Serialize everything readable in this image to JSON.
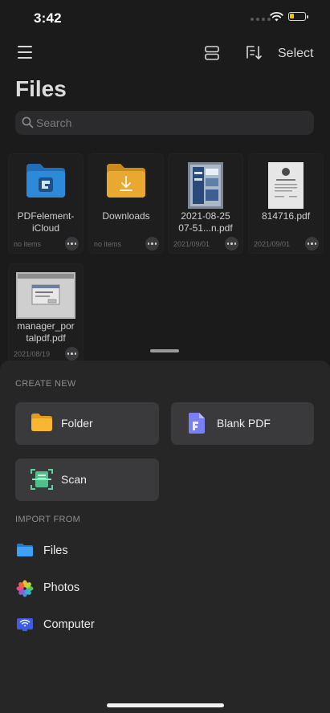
{
  "status_bar": {
    "time": "3:42",
    "battery_level": 0.3
  },
  "toolbar": {
    "select_label": "Select"
  },
  "page": {
    "title": "Files"
  },
  "search": {
    "placeholder": "Search"
  },
  "files": [
    {
      "name_line1": "PDFelement-",
      "name_line2": "iCloud",
      "meta": "no items",
      "kind": "cloud-folder-icon"
    },
    {
      "name_line1": "Downloads",
      "name_line2": "",
      "meta": "no items",
      "kind": "downloads-folder-icon"
    },
    {
      "name_line1": "2021-08-25",
      "name_line2": "07-51...n.pdf",
      "meta": "2021/09/01",
      "kind": "pdf-thumbnail"
    },
    {
      "name_line1": "814716.pdf",
      "name_line2": "",
      "meta": "2021/09/01",
      "kind": "pdf-thumbnail"
    },
    {
      "name_line1": "manager_por",
      "name_line2": "talpdf.pdf",
      "meta": "2021/08/19",
      "kind": "pdf-thumbnail"
    }
  ],
  "create_new": {
    "label": "CREATE NEW",
    "folder": "Folder",
    "blank_pdf": "Blank PDF",
    "scan": "Scan"
  },
  "import_from": {
    "label": "IMPORT FROM",
    "items": [
      "Files",
      "Photos",
      "Computer"
    ]
  },
  "colors": {
    "background": "#1b1b1c",
    "sheet": "#262627",
    "card": "#3a3a3c",
    "folder_blue": "#2d8ad8",
    "folder_yellow": "#e9a930"
  }
}
